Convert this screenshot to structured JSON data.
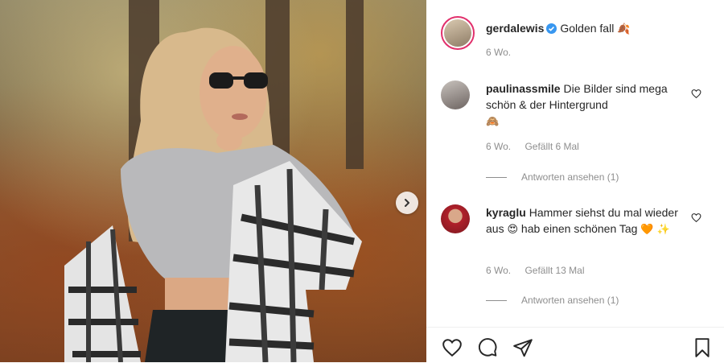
{
  "post": {
    "owner": "gerdalewis",
    "caption": "Golden fall",
    "caption_emoji": "🍂",
    "age": "6 Wo."
  },
  "comments": [
    {
      "user": "paulinassmile",
      "text": "Die Bilder sind mega schön & der Hintergrund",
      "emoji": "🙈",
      "age": "6 Wo.",
      "likes": "Gefällt 6 Mal",
      "replies": "Antworten ansehen (1)"
    },
    {
      "user": "kyraglu",
      "text": "Hammer siehst du mal wieder aus",
      "emoji_mid": "😍",
      "text2": "hab einen schönen Tag",
      "emoji_end": "🧡 ✨",
      "age": "6 Wo.",
      "likes": "Gefällt 13 Mal",
      "replies": "Antworten ansehen (1)"
    }
  ],
  "icons": {
    "verified": "verified-badge-icon",
    "next": "chevron-right-icon",
    "heart": "heart-icon",
    "comment": "comment-icon",
    "share": "share-icon",
    "save": "bookmark-icon"
  },
  "colors": {
    "verified": "#3897f0",
    "text": "#262626",
    "muted": "#8e8e8e",
    "story_ring": "#e1306c"
  }
}
